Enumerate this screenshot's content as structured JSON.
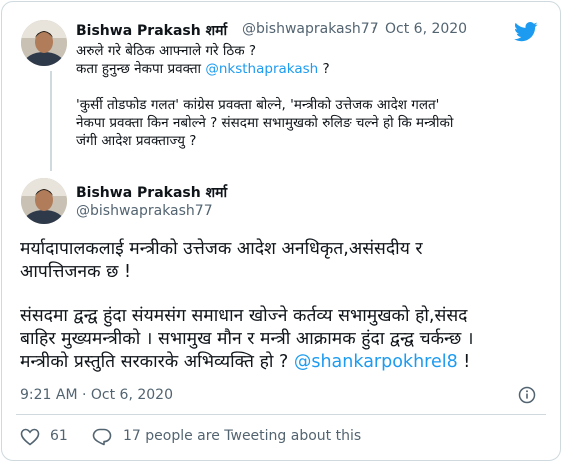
{
  "reply_tweet": {
    "author_name": "Bishwa Prakash शर्मा",
    "handle": "@bishwaprakash77",
    "separator": "·",
    "date": "Oct 6, 2020",
    "line1": "अरुले गरे बेठिक आफ्नाले गरे ठिक ?",
    "line2_prefix": "कता हुनुन्छ नेकपा प्रवक्ता ",
    "line2_mention": "@nksthaprakash",
    "line2_suffix": " ?",
    "line3": "'कुर्सी तोडफोड गलत' कांग्रेस प्रवक्ता बोल्ने, 'मन्त्रीको उत्तेजक आदेश गलत'",
    "line4": "नेकपा प्रवक्ता किन नबोल्ने ? संसदमा सभामुखको रुलिङ चल्ने हो कि मन्त्रीको",
    "line5": "जंगी आदेश प्रवक्ताज्यु ?"
  },
  "main_tweet": {
    "author_name": "Bishwa Prakash शर्मा",
    "handle": "@bishwaprakash77",
    "para1_line1": "मर्यादापालकलाई मन्त्रीको उत्तेजक आदेश अनधिकृत,असंसदीय र",
    "para1_line2": "आपत्तिजनक छ !",
    "para2_line1": "संसदमा द्वन्द्व हुंदा संयमसंग समाधान खोज्ने कर्तव्य सभामुखको हो,संसद",
    "para2_line2": "बाहिर मुख्यमन्त्रीको । सभामुख मौन र मन्त्री आक्रामक हुंदा द्वन्द्व चर्कन्छ ।",
    "para2_line3_prefix": "मन्त्रीको प्रस्तुति सरकारके अभिव्यक्ति हो ? ",
    "para2_line3_mention": "@shankarpokhrel8",
    "para2_line3_suffix": " !",
    "timestamp": "9:21 AM · Oct 6, 2020",
    "like_count": "61",
    "tweeting_text": "17 people are Tweeting about this"
  },
  "icons": {
    "twitter": "twitter-bird-icon",
    "info": "info-icon",
    "like": "heart-icon",
    "reply": "speech-bubble-icon"
  },
  "colors": {
    "accent": "#1d9bf0",
    "text": "#0f1419",
    "muted": "#536471",
    "border": "#cfd9de"
  }
}
